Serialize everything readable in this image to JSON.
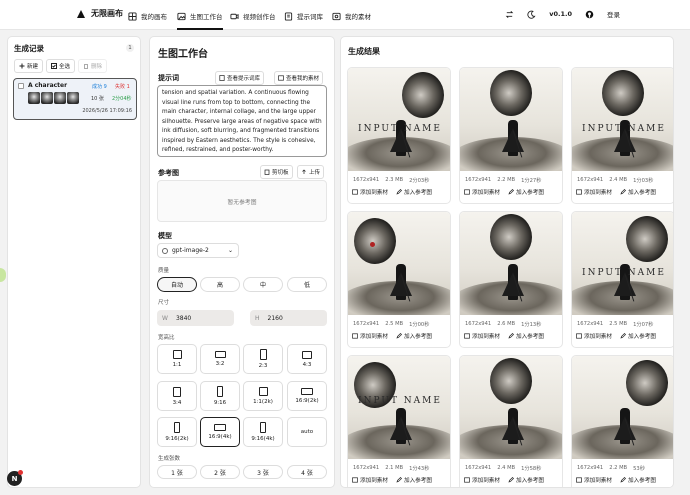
{
  "nav": {
    "brand": "无限画布",
    "items": [
      "我的画布",
      "生图工作台",
      "视频创作台",
      "提示词库",
      "我的素材"
    ],
    "version": "v0.1.0",
    "login": "登录"
  },
  "left": {
    "title": "生成记录",
    "count": "1",
    "new": "新建",
    "select_all": "全选",
    "delete": "删除",
    "record": {
      "name": "A character",
      "success": "成功 9",
      "fail": "失败 1",
      "count": "10 张",
      "duration": "2分04秒",
      "date": "2026/5/26 17:09:16"
    }
  },
  "mid": {
    "title": "生图工作台",
    "prompt_label": "提示词",
    "view_prompt_lib": "查看提示词库",
    "view_my_assets": "查看我的素材",
    "prompt_text": "tension and spatial variation. A continuous flowing visual line runs from top to bottom, connecting the main character, internal collage, and the large upper silhouette. Preserve large areas of negative space with ink diffusion, soft blurring, and fragmented transitions inspired by Eastern aesthetics. The style is cohesive, refined, restrained, and poster-worthy.",
    "ref_label": "参考图",
    "clipboard": "剪切板",
    "upload": "上传",
    "no_ref": "暂无参考图",
    "model_label": "模型",
    "model": "gpt-image-2",
    "quality_label": "质量",
    "quality": [
      "自动",
      "高",
      "中",
      "低"
    ],
    "size_label": "尺寸",
    "width_key": "W",
    "width": "3840",
    "height_key": "H",
    "height": "2160",
    "ratio_label": "宽高比",
    "ratios": [
      "1:1",
      "3:2",
      "2:3",
      "4:3",
      "3:4",
      "9:16",
      "1:1(2k)",
      "16:9(2k)",
      "9:16(2k)",
      "16:9(4k)",
      "9:16(4k)",
      "auto"
    ],
    "count_label": "生成张数",
    "counts": [
      "1 张",
      "2 张",
      "3 张",
      "4 张"
    ]
  },
  "right": {
    "title": "生成结果",
    "add_asset": "添加到素材",
    "add_ref": "加入参考图",
    "cards": [
      {
        "res": "1672x941",
        "size": "2.3 MB",
        "time": "2分03秒",
        "text": "INPUT NAME"
      },
      {
        "res": "1672x941",
        "size": "2.2 MB",
        "time": "1分27秒",
        "text": ""
      },
      {
        "res": "1672x941",
        "size": "2.4 MB",
        "time": "1分03秒",
        "text": "INPUT NAME"
      },
      {
        "res": "1672x941",
        "size": "2.5 MB",
        "time": "1分00秒",
        "text": ""
      },
      {
        "res": "1672x941",
        "size": "2.6 MB",
        "time": "1分13秒",
        "text": ""
      },
      {
        "res": "1672x941",
        "size": "2.5 MB",
        "time": "1分07秒",
        "text": "INPUT NAME"
      },
      {
        "res": "1672x941",
        "size": "2.1 MB",
        "time": "1分43秒",
        "text": "INPUT NAME"
      },
      {
        "res": "1672x941",
        "size": "2.4 MB",
        "time": "1分58秒",
        "text": ""
      },
      {
        "res": "1672x941",
        "size": "2.2 MB",
        "time": "53秒",
        "text": ""
      }
    ]
  },
  "dock_letter": "N"
}
